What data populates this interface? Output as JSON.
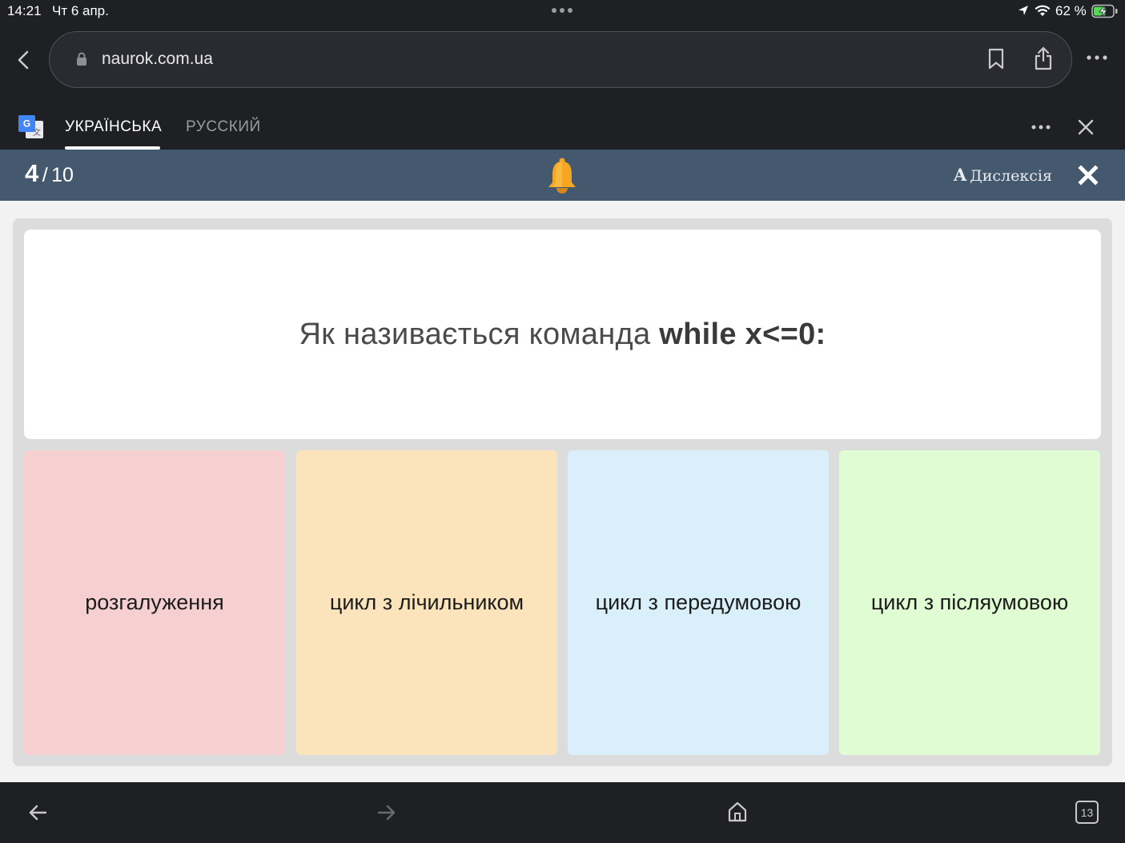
{
  "status_bar": {
    "time": "14:21",
    "date": "Чт 6 апр.",
    "battery_percent": "62 %",
    "battery_level": 0.62
  },
  "browser": {
    "url": "naurok.com.ua",
    "open_tabs": "13"
  },
  "translate_bar": {
    "languages": [
      "УКРАЇНСЬКА",
      "РУССКИЙ"
    ],
    "active_language": "УКРАЇНСЬКА"
  },
  "quiz": {
    "progress_current": "4",
    "progress_separator": "/",
    "progress_total": "10",
    "dyslexia_label": "Дислексія",
    "dyslexia_glyph": "A",
    "question_prefix": "Як називається команда ",
    "question_code": "while x<=0:",
    "answers": [
      {
        "label": "розгалуження",
        "color": "#f6cfd1"
      },
      {
        "label": "цикл з лічильником",
        "color": "#fbe3bc"
      },
      {
        "label": "цикл з передумовою",
        "color": "#d9f0fa"
      },
      {
        "label": "цикл з післяумовою",
        "color": "#dffcd2"
      }
    ],
    "header_color": "#44596e",
    "bell_color": "#f5a623"
  }
}
